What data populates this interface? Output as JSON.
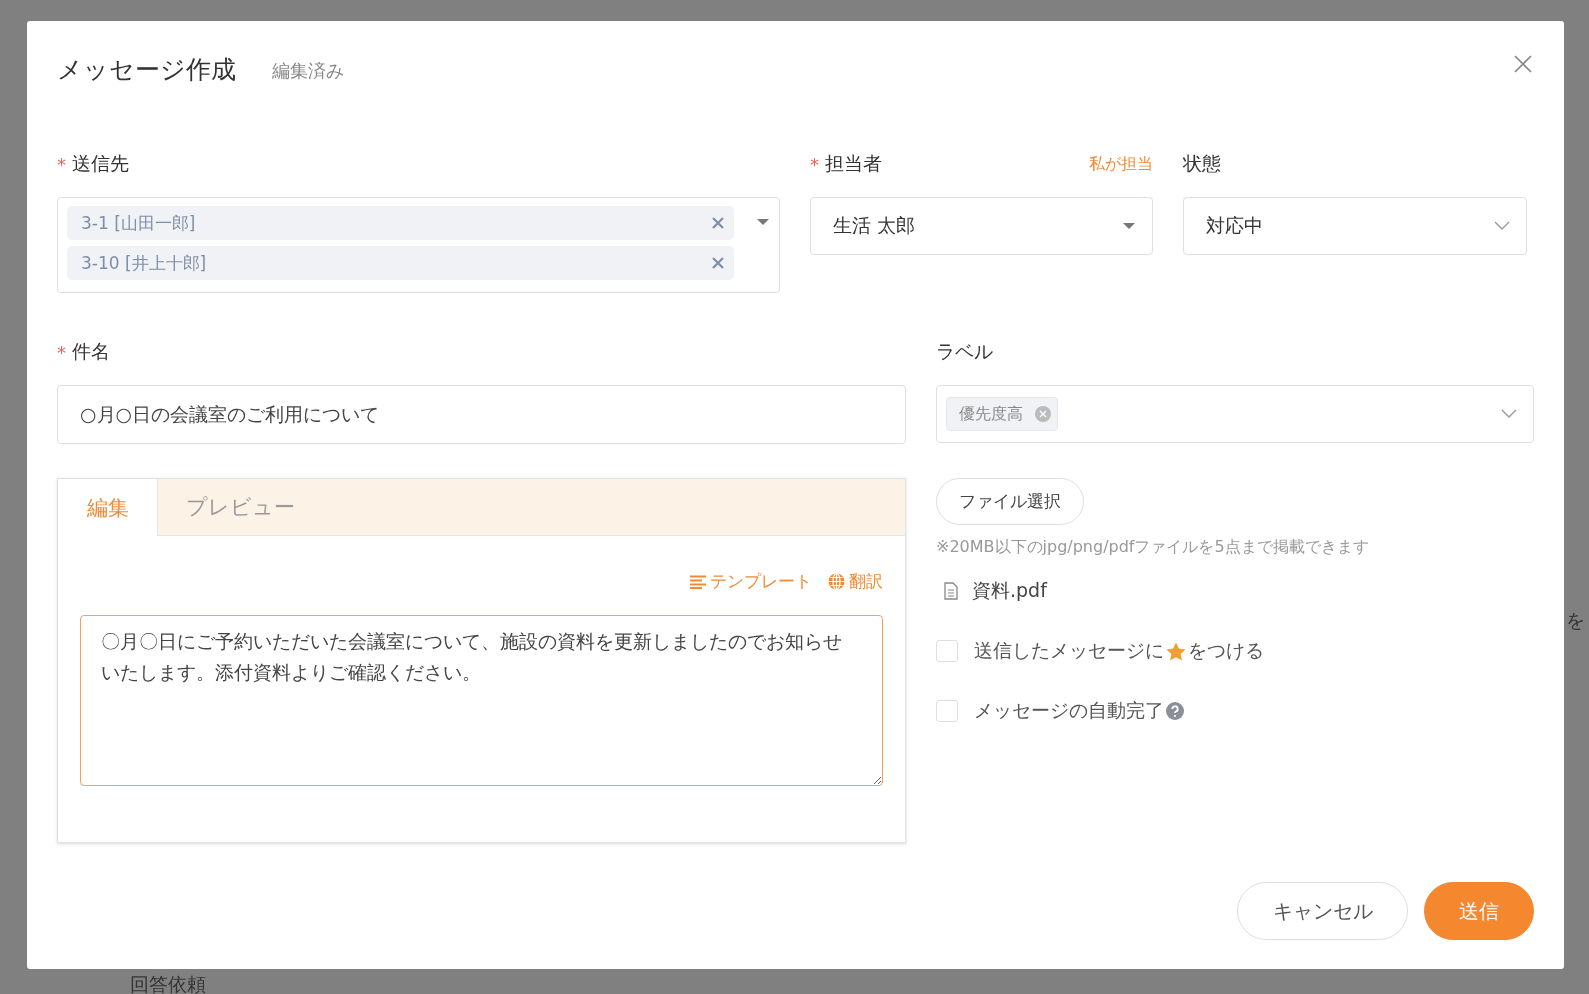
{
  "background": {
    "texts": [
      "回答依頼",
      "を"
    ]
  },
  "dialog": {
    "title": "メッセージ作成",
    "edit_status": "編集済み",
    "recipients": {
      "label": "送信先",
      "mark": "*",
      "tags": [
        "3-1 [山田一郎]",
        "3-10 [井上十郎]"
      ]
    },
    "assignee": {
      "label": "担当者",
      "mark": "*",
      "action": "私が担当",
      "value": "生活 太郎"
    },
    "status": {
      "label": "状態",
      "value": "対応中"
    },
    "subject": {
      "label": "件名",
      "mark": "*",
      "value": "○月○日の会議室のご利用について"
    },
    "labels": {
      "label": "ラベル",
      "tags": [
        "優先度高"
      ]
    },
    "editor": {
      "tabs": [
        {
          "label": "編集",
          "selected": true
        },
        {
          "label": "プレビュー",
          "selected": false
        }
      ],
      "tools": [
        {
          "kind": "template",
          "label": "テンプレート"
        },
        {
          "kind": "translate",
          "label": "翻訳"
        }
      ],
      "body": "〇月〇日にご予約いただいた会議室について、施設の資料を更新しましたのでお知らせいたします。添付資料よりご確認ください。"
    },
    "attachments": {
      "button": "ファイル選択",
      "note": "※20MB以下のjpg/png/pdfファイルを5点まで掲載できます",
      "files": [
        "資料.pdf"
      ]
    },
    "options": [
      {
        "kind": "star",
        "text_before": "送信したメッセージに",
        "text_after": "をつける",
        "checked": false
      },
      {
        "kind": "help",
        "text_before": "メッセージの自動完了",
        "checked": false
      }
    ],
    "buttons": [
      {
        "kind": "secondary",
        "label": "キャンセル"
      },
      {
        "kind": "primary",
        "label": "送信"
      }
    ]
  }
}
